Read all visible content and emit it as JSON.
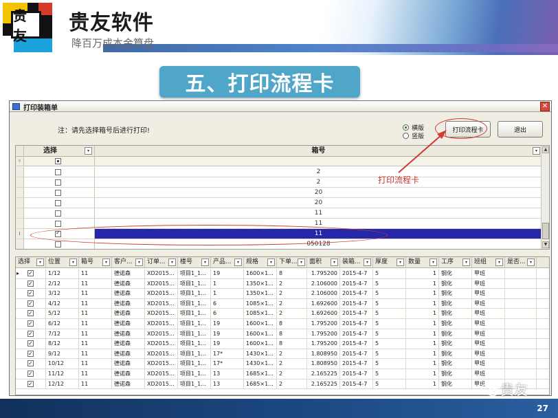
{
  "header": {
    "brand": "贵友软件",
    "tagline": "降百万成本金算盘",
    "logo_text": "贵友"
  },
  "section_title": "五、打印流程卡",
  "dialog": {
    "title": "打印装箱单",
    "close": "✕",
    "hint": "注：请先选择箱号后进行打印!",
    "orientation": {
      "landscape": "横版",
      "portrait": "竖版",
      "selected": "landscape"
    },
    "print_button": "打印流程卡",
    "exit_button": "退出",
    "annotation": "打印流程卡"
  },
  "box_grid": {
    "headers": {
      "select": "选择",
      "box_no": "箱号"
    },
    "rows": [
      {
        "box_no": "2",
        "checked": false,
        "selected": false
      },
      {
        "box_no": "2",
        "checked": false,
        "selected": false
      },
      {
        "box_no": "20",
        "checked": false,
        "selected": false
      },
      {
        "box_no": "20",
        "checked": false,
        "selected": false
      },
      {
        "box_no": "11",
        "checked": false,
        "selected": false
      },
      {
        "box_no": "11",
        "checked": false,
        "selected": false
      },
      {
        "box_no": "11",
        "checked": true,
        "selected": true
      },
      {
        "box_no": "050128",
        "checked": false,
        "selected": false
      }
    ]
  },
  "detail_grid": {
    "columns": [
      "选择",
      "位置",
      "箱号",
      "客户...",
      "订单...",
      "楼号",
      "产品...",
      "规格",
      "下单...",
      "面积",
      "装箱...",
      "厚度",
      "数量",
      "工序",
      "班组",
      "是否..."
    ],
    "rows": [
      {
        "checked": true,
        "position": "1/12",
        "box": "11",
        "customer": "德诺森",
        "order": "XD2015...",
        "building": "项目1_1...",
        "product": "19",
        "spec": "1600×1...",
        "qty_order": "8",
        "area": "1.795200",
        "pack_date": "2015-4-7",
        "thickness": "5",
        "count": "1",
        "process": "钢化",
        "team": "甲班",
        "is": ""
      },
      {
        "checked": true,
        "position": "2/12",
        "box": "11",
        "customer": "德诺森",
        "order": "XD2015...",
        "building": "项目1_1...",
        "product": "1",
        "spec": "1350×1...",
        "qty_order": "2",
        "area": "2.106000",
        "pack_date": "2015-4-7",
        "thickness": "5",
        "count": "1",
        "process": "钢化",
        "team": "甲班",
        "is": ""
      },
      {
        "checked": true,
        "position": "3/12",
        "box": "11",
        "customer": "德诺森",
        "order": "XD2015...",
        "building": "项目1_1...",
        "product": "1",
        "spec": "1350×1...",
        "qty_order": "2",
        "area": "2.106000",
        "pack_date": "2015-4-7",
        "thickness": "5",
        "count": "1",
        "process": "钢化",
        "team": "甲班",
        "is": ""
      },
      {
        "checked": true,
        "position": "4/12",
        "box": "11",
        "customer": "德诺森",
        "order": "XD2015...",
        "building": "项目1_1...",
        "product": "6",
        "spec": "1085×1...",
        "qty_order": "2",
        "area": "1.692600",
        "pack_date": "2015-4-7",
        "thickness": "5",
        "count": "1",
        "process": "钢化",
        "team": "甲班",
        "is": ""
      },
      {
        "checked": true,
        "position": "5/12",
        "box": "11",
        "customer": "德诺森",
        "order": "XD2015...",
        "building": "项目1_1...",
        "product": "6",
        "spec": "1085×1...",
        "qty_order": "2",
        "area": "1.692600",
        "pack_date": "2015-4-7",
        "thickness": "5",
        "count": "1",
        "process": "钢化",
        "team": "甲班",
        "is": ""
      },
      {
        "checked": true,
        "position": "6/12",
        "box": "11",
        "customer": "德诺森",
        "order": "XD2015...",
        "building": "项目1_1...",
        "product": "19",
        "spec": "1600×1...",
        "qty_order": "8",
        "area": "1.795200",
        "pack_date": "2015-4-7",
        "thickness": "5",
        "count": "1",
        "process": "钢化",
        "team": "甲班",
        "is": ""
      },
      {
        "checked": true,
        "position": "7/12",
        "box": "11",
        "customer": "德诺森",
        "order": "XD2015...",
        "building": "项目1_1...",
        "product": "19",
        "spec": "1600×1...",
        "qty_order": "8",
        "area": "1.795200",
        "pack_date": "2015-4-7",
        "thickness": "5",
        "count": "1",
        "process": "钢化",
        "team": "甲班",
        "is": ""
      },
      {
        "checked": true,
        "position": "8/12",
        "box": "11",
        "customer": "德诺森",
        "order": "XD2015...",
        "building": "项目1_1...",
        "product": "19",
        "spec": "1600×1...",
        "qty_order": "8",
        "area": "1.795200",
        "pack_date": "2015-4-7",
        "thickness": "5",
        "count": "1",
        "process": "钢化",
        "team": "甲班",
        "is": ""
      },
      {
        "checked": true,
        "position": "9/12",
        "box": "11",
        "customer": "德诺森",
        "order": "XD2015...",
        "building": "项目1_1...",
        "product": "17*",
        "spec": "1430×1...",
        "qty_order": "2",
        "area": "1.808950",
        "pack_date": "2015-4-7",
        "thickness": "5",
        "count": "1",
        "process": "钢化",
        "team": "甲班",
        "is": ""
      },
      {
        "checked": true,
        "position": "10/12",
        "box": "11",
        "customer": "德诺森",
        "order": "XD2015...",
        "building": "项目1_1...",
        "product": "17*",
        "spec": "1430×1...",
        "qty_order": "2",
        "area": "1.808950",
        "pack_date": "2015-4-7",
        "thickness": "5",
        "count": "1",
        "process": "钢化",
        "team": "甲班",
        "is": ""
      },
      {
        "checked": true,
        "position": "11/12",
        "box": "11",
        "customer": "德诺森",
        "order": "XD2015...",
        "building": "项目1_1...",
        "product": "13",
        "spec": "1685×1...",
        "qty_order": "2",
        "area": "2.165225",
        "pack_date": "2015-4-7",
        "thickness": "5",
        "count": "1",
        "process": "钢化",
        "team": "甲班",
        "is": ""
      },
      {
        "checked": true,
        "position": "12/12",
        "box": "11",
        "customer": "德诺森",
        "order": "XD2015...",
        "building": "项目1_1...",
        "product": "13",
        "spec": "1685×1...",
        "qty_order": "2",
        "area": "2.165225",
        "pack_date": "2015-4-7",
        "thickness": "5",
        "count": "1",
        "process": "钢化",
        "team": "甲班",
        "is": ""
      }
    ]
  },
  "footer": {
    "page_number": "27",
    "wechat_brand": "贵友"
  },
  "colors": {
    "title_bg": "#4fa6c9",
    "selected_row": "#2527a8",
    "annotation": "#d23a32",
    "footer": "#1d4b86"
  }
}
